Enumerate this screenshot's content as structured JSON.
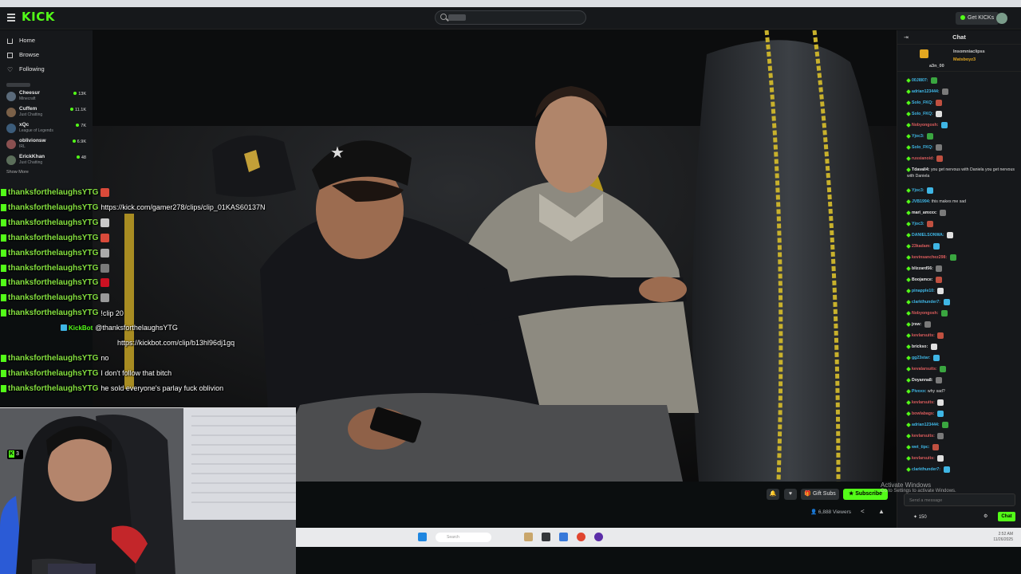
{
  "brand": {
    "logo": "KICK",
    "accent": "#53fc18"
  },
  "nav": {
    "items": [
      {
        "label": "Home",
        "icon": "home-icon"
      },
      {
        "label": "Browse",
        "icon": "browse-icon"
      },
      {
        "label": "Following",
        "icon": "heart-icon"
      }
    ],
    "channels": [
      {
        "name": "Cheesur",
        "category": "Minecraft",
        "viewers": "13K",
        "color": "#5a6a7a"
      },
      {
        "name": "Cuffem",
        "category": "Just Chatting",
        "viewers": "11.1K",
        "color": "#7a6048"
      },
      {
        "name": "xQc",
        "category": "League of Legends",
        "viewers": "7K",
        "color": "#3c5c7a"
      },
      {
        "name": "oblivionsw",
        "category": "IRL",
        "viewers": "6.9K",
        "color": "#8a5050"
      },
      {
        "name": "ErickKhan",
        "category": "Just Chatting",
        "viewers": "48",
        "color": "#5b6e5a"
      }
    ],
    "show_more": "Show More"
  },
  "topbar": {
    "get_kicks": "Get KICKs",
    "search_placeholder": ""
  },
  "overlay_chat": [
    {
      "user": "thanksforthelaughsYTG",
      "msg": ""
    },
    {
      "user": "thanksforthelaughsYTG",
      "msg": "https://kick.com/gamer278/clips/clip_01KAS60137N"
    },
    {
      "user": "thanksforthelaughsYTG",
      "msg": ""
    },
    {
      "user": "thanksforthelaughsYTG",
      "msg": ""
    },
    {
      "user": "thanksforthelaughsYTG",
      "msg": ""
    },
    {
      "user": "thanksforthelaughsYTG",
      "msg": ""
    },
    {
      "user": "thanksforthelaughsYTG",
      "msg": ""
    },
    {
      "user": "thanksforthelaughsYTG",
      "msg": ""
    },
    {
      "user": "thanksforthelaughsYTG",
      "msg": "!clip 20"
    },
    {
      "user": "KickBot",
      "msg": "@thanksforthelaughsYTG"
    },
    {
      "user": "",
      "msg": "https://kickbot.com/clip/b13hl96dj1gq"
    },
    {
      "user": "thanksforthelaughsYTG",
      "msg": "no"
    },
    {
      "user": "thanksforthelaughsYTG",
      "msg": "I don't follow that bitch"
    },
    {
      "user": "thanksforthelaughsYTG",
      "msg": "he sold everyone's parlay fuck oblivion"
    }
  ],
  "webcam": {
    "badge": "3"
  },
  "controls": {
    "gift_subs": "Gift Subs",
    "subscribe": "Subscribe",
    "viewers": "6,888 Viewers"
  },
  "chat": {
    "title": "Chat",
    "pinned": [
      {
        "name": "a3n_00",
        "color": "#c9c9c9"
      },
      {
        "name": "Insomniaclipss",
        "color": "#c9c9c9"
      },
      {
        "name": "Matsboyz3",
        "color": "#e3a720"
      }
    ],
    "messages": [
      {
        "user": "00JI807:",
        "text": "",
        "color": "#3fb6e5"
      },
      {
        "user": "adrian123444:",
        "text": "",
        "color": "#3fb6e5"
      },
      {
        "user": "Solo_FKQ:",
        "text": "",
        "color": "#3fb6e5"
      },
      {
        "user": "Solo_FKQ:",
        "text": "",
        "color": "#3fb6e5"
      },
      {
        "user": "Nobyongosh:",
        "text": "",
        "color": "#d95c5c"
      },
      {
        "user": "Yjoc3:",
        "text": "",
        "color": "#3fb6e5"
      },
      {
        "user": "Solo_FKQ:",
        "text": "",
        "color": "#3fb6e5"
      },
      {
        "user": "russianoid:",
        "text": "",
        "color": "#d95c5c"
      },
      {
        "user": "Tdavali4:",
        "text": "you get nervous with Daniela you get nervous with Daniela",
        "color": "#e6e6e6"
      },
      {
        "user": "Yjoc3:",
        "text": "",
        "color": "#3fb6e5"
      },
      {
        "user": "JVB1994:",
        "text": "this makes me sad",
        "color": "#3fb6e5"
      },
      {
        "user": "mari_amxxx:",
        "text": "",
        "color": "#e6e6e6"
      },
      {
        "user": "Yjoc3:",
        "text": "",
        "color": "#3fb6e5"
      },
      {
        "user": "DANIELSONWA:",
        "text": "",
        "color": "#3fb6e5"
      },
      {
        "user": "23kadam:",
        "text": "",
        "color": "#d95c5c"
      },
      {
        "user": "kevinsanchez298:",
        "text": "",
        "color": "#d95c5c"
      },
      {
        "user": "blizzard56:",
        "text": "",
        "color": "#e6e6e6"
      },
      {
        "user": "Boojamce:",
        "text": "",
        "color": "#e6e6e6"
      },
      {
        "user": "pinapple10:",
        "text": "",
        "color": "#3fb6e5"
      },
      {
        "user": "clarkthunder7:",
        "text": "",
        "color": "#3fb6e5"
      },
      {
        "user": "Nobyongosh:",
        "text": "",
        "color": "#d95c5c"
      },
      {
        "user": "jrsw:",
        "text": "",
        "color": "#e6e6e6"
      },
      {
        "user": "kevlarsuits:",
        "text": "",
        "color": "#d95c5c"
      },
      {
        "user": "brickso:",
        "text": "",
        "color": "#e6e6e6"
      },
      {
        "user": "gg23star:",
        "text": "",
        "color": "#3fb6e5"
      },
      {
        "user": "kevalarsuits:",
        "text": "",
        "color": "#d95c5c"
      },
      {
        "user": "Doyanna8:",
        "text": "",
        "color": "#e6e6e6"
      },
      {
        "user": "Pivoxx:",
        "text": "why sad?",
        "color": "#3fb6e5"
      },
      {
        "user": "kevlarsuits:",
        "text": "",
        "color": "#d95c5c"
      },
      {
        "user": "bowlabags:",
        "text": "",
        "color": "#d95c5c"
      },
      {
        "user": "adrian123444:",
        "text": "",
        "color": "#3fb6e5"
      },
      {
        "user": "kevlarsuits:",
        "text": "",
        "color": "#d95c5c"
      },
      {
        "user": "wet_tipc:",
        "text": "",
        "color": "#3fb6e5"
      },
      {
        "user": "kevlarsuits:",
        "text": "",
        "color": "#d95c5c"
      },
      {
        "user": "clarkthunder7:",
        "text": "",
        "color": "#3fb6e5"
      }
    ],
    "input_placeholder": "Send a message",
    "kicks_count": "150",
    "chat_button": "Chat"
  },
  "windows_watermark": {
    "title": "Activate Windows",
    "subtitle": "Go to Settings to activate Windows."
  },
  "taskbar": {
    "search_placeholder": "Search",
    "time": "2:52 AM",
    "date": "11/26/2025"
  }
}
